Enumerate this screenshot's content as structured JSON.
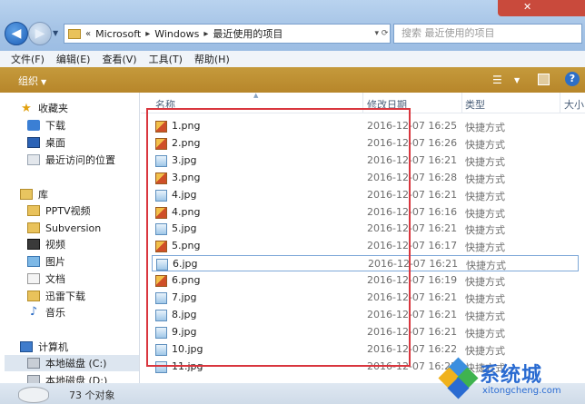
{
  "address": {
    "prefix": "«",
    "crumbs": [
      "Microsoft",
      "Windows",
      "最近使用的项目"
    ]
  },
  "search": {
    "placeholder": "搜索 最近使用的项目"
  },
  "menu": [
    "文件(F)",
    "编辑(E)",
    "查看(V)",
    "工具(T)",
    "帮助(H)"
  ],
  "toolbar": {
    "organize": "组织",
    "help": "?"
  },
  "nav": {
    "favorites": "收藏夹",
    "downloads": "下载",
    "desktop": "桌面",
    "recent": "最近访问的位置",
    "libraries": "库",
    "pptv": "PPTV视频",
    "subversion": "Subversion",
    "video": "视频",
    "pictures": "图片",
    "documents": "文档",
    "xunlei": "迅雷下载",
    "music": "音乐",
    "computer": "计算机",
    "disk_c": "本地磁盘 (C:)",
    "disk_d": "本地磁盘 (D:)"
  },
  "columns": {
    "name": "名称",
    "date": "修改日期",
    "type": "类型",
    "size": "大小"
  },
  "files": [
    {
      "name": "1.png",
      "date": "2016-12-07 16:25",
      "type": "快捷方式",
      "kind": "png"
    },
    {
      "name": "2.png",
      "date": "2016-12-07 16:26",
      "type": "快捷方式",
      "kind": "png"
    },
    {
      "name": "3.jpg",
      "date": "2016-12-07 16:21",
      "type": "快捷方式",
      "kind": "jpg"
    },
    {
      "name": "3.png",
      "date": "2016-12-07 16:28",
      "type": "快捷方式",
      "kind": "png"
    },
    {
      "name": "4.jpg",
      "date": "2016-12-07 16:21",
      "type": "快捷方式",
      "kind": "jpg"
    },
    {
      "name": "4.png",
      "date": "2016-12-07 16:16",
      "type": "快捷方式",
      "kind": "png"
    },
    {
      "name": "5.jpg",
      "date": "2016-12-07 16:21",
      "type": "快捷方式",
      "kind": "jpg"
    },
    {
      "name": "5.png",
      "date": "2016-12-07 16:17",
      "type": "快捷方式",
      "kind": "png"
    },
    {
      "name": "6.jpg",
      "date": "2016-12-07 16:21",
      "type": "快捷方式",
      "kind": "jpg"
    },
    {
      "name": "6.png",
      "date": "2016-12-07 16:19",
      "type": "快捷方式",
      "kind": "png"
    },
    {
      "name": "7.jpg",
      "date": "2016-12-07 16:21",
      "type": "快捷方式",
      "kind": "jpg"
    },
    {
      "name": "8.jpg",
      "date": "2016-12-07 16:21",
      "type": "快捷方式",
      "kind": "jpg"
    },
    {
      "name": "9.jpg",
      "date": "2016-12-07 16:21",
      "type": "快捷方式",
      "kind": "jpg"
    },
    {
      "name": "10.jpg",
      "date": "2016-12-07 16:22",
      "type": "快捷方式",
      "kind": "jpg"
    },
    {
      "name": "11.jpg",
      "date": "2016-12-07 16:22",
      "type": "快捷方式",
      "kind": "jpg"
    }
  ],
  "selected_file": "6.jpg",
  "status": {
    "count": "73 个对象"
  },
  "watermark": {
    "text": "系统城",
    "url": "xitongcheng.com"
  },
  "colors": {
    "command_bar": "#b7862a",
    "highlight_box": "#d9363e",
    "title_bar": "#a6c4e6"
  }
}
